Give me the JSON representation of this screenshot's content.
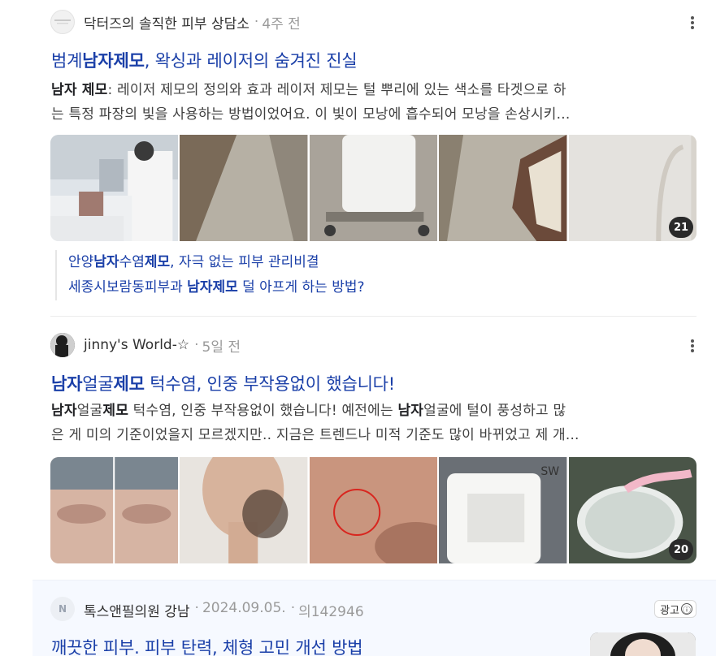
{
  "posts": [
    {
      "source": "닥터즈의 솔직한 피부 상담소",
      "separator": "·",
      "date": "4주 전",
      "title": [
        "범계",
        "남자제모",
        ", 왁싱과 레이저의 숨겨진 진실"
      ],
      "snippet_line1": [
        "남자 제모",
        ": 레이저 제모의 정의와 효과 레이저 제모는 털 뿌리에 있는 색소를 타겟으로 하"
      ],
      "snippet_line2": "는 특정 파장의 빛을 사용하는 방법이었어요. 이 빛이 모낭에 흡수되어 모낭을 손상시키...",
      "image_count": "21",
      "related": [
        [
          "안양",
          "남자",
          "수염",
          "제모",
          ", 자극 없는 피부 관리비결"
        ],
        [
          "세종시보람동피부과 ",
          "남자제모",
          " 덜 아프게 하는 방법?"
        ]
      ]
    },
    {
      "source": "jinny's World-☆",
      "separator": "·",
      "date": "5일 전",
      "title": [
        "남자",
        "얼굴",
        "제모",
        " 턱수염, 인중 부작용없이 했습니다!"
      ],
      "snippet_line1": [
        "남자",
        "얼굴",
        "제모",
        " 턱수염, 인중 부작용없이 했습니다! 예전에는 ",
        "남자",
        "얼굴에 털이 풍성하고 많"
      ],
      "snippet_line2": "은 게 미의 기준이었을지 모르겠지만.. 지금은 트렌드나 미적 기준도 많이 바뀌었고 제 개...",
      "image_count": "20"
    }
  ],
  "ad": {
    "avatar_letter": "N",
    "source": "톡스앤필의원 강남",
    "separator": "·",
    "date": "2024.09.05.",
    "views": "의142946",
    "badge": "광고",
    "badge_icon": "ⓘ",
    "title": "깨끗한 피부. 피부 탄력, 체형 고민 개선 방법"
  },
  "colors": {
    "link": "#1a3fa8",
    "ad_bg": "#f6f9ff"
  }
}
